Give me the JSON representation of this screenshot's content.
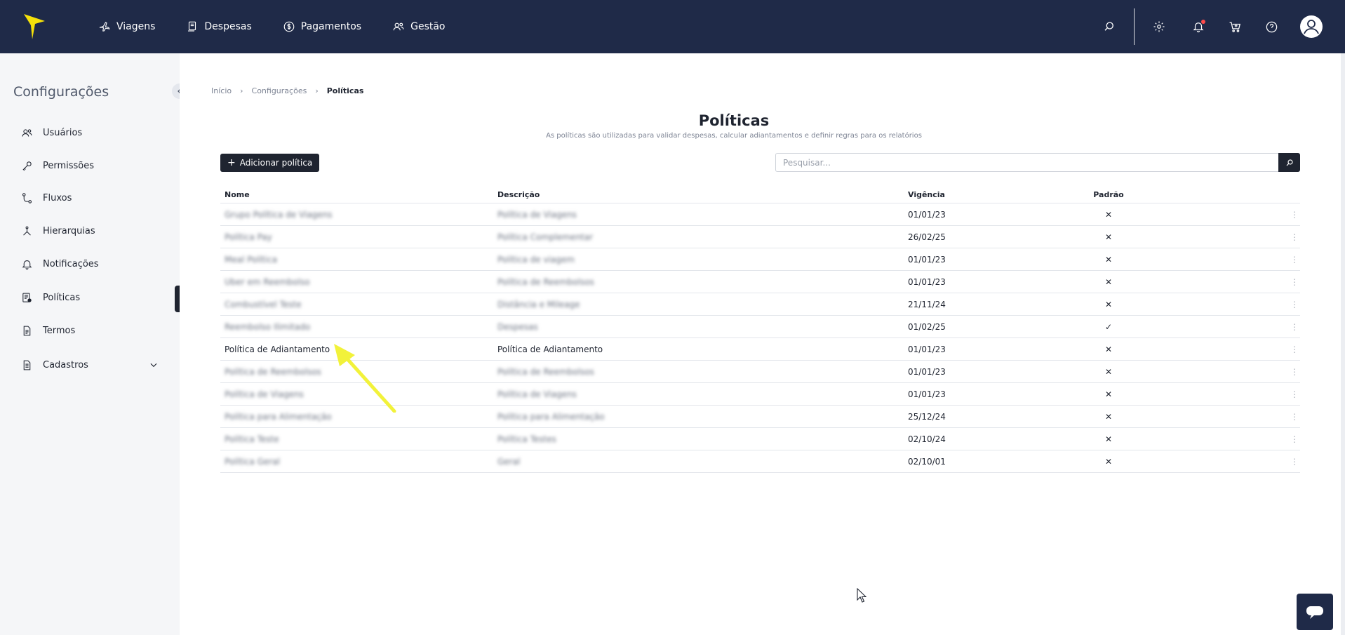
{
  "nav": {
    "items": [
      {
        "label": "Viagens",
        "icon": "plane-icon"
      },
      {
        "label": "Despesas",
        "icon": "receipt-icon"
      },
      {
        "label": "Pagamentos",
        "icon": "dollar-icon"
      },
      {
        "label": "Gestão",
        "icon": "users-icon"
      }
    ],
    "icons": [
      "search-icon",
      "gear-icon",
      "bell-icon",
      "cart-icon",
      "help-icon",
      "avatar-icon"
    ],
    "colors": {
      "navbar": "#1f2a48",
      "logo": "#f5e10a",
      "notification_dot": "#ff4b4b"
    }
  },
  "sidebar": {
    "title": "Configurações",
    "items": [
      {
        "label": "Usuários",
        "icon": "users-icon"
      },
      {
        "label": "Permissões",
        "icon": "key-icon"
      },
      {
        "label": "Fluxos",
        "icon": "flow-icon"
      },
      {
        "label": "Hierarquias",
        "icon": "hierarchy-icon"
      },
      {
        "label": "Notificações",
        "icon": "bell-icon"
      },
      {
        "label": "Políticas",
        "icon": "policy-icon",
        "active": true
      },
      {
        "label": "Termos",
        "icon": "document-icon"
      },
      {
        "label": "Cadastros",
        "icon": "records-icon",
        "expandable": true
      }
    ]
  },
  "breadcrumb": {
    "items": [
      "Início",
      "Configurações",
      "Políticas"
    ]
  },
  "page": {
    "title": "Políticas",
    "subtitle": "As políticas são utilizadas para validar despesas, calcular adiantamentos e definir regras para os relatórios"
  },
  "toolbar": {
    "add_label": "Adicionar política",
    "search_placeholder": "Pesquisar..."
  },
  "table": {
    "headers": {
      "nome": "Nome",
      "descricao": "Descrição",
      "vigencia": "Vigência",
      "padrao": "Padrão"
    },
    "rows": [
      {
        "nome": "Grupo Política de Viagens",
        "descricao": "Política de Viagens",
        "vigencia": "01/01/23",
        "padrao": "✕",
        "blurred": true
      },
      {
        "nome": "Política Pay",
        "descricao": "Política Complementar",
        "vigencia": "26/02/25",
        "padrao": "✕",
        "blurred": true
      },
      {
        "nome": "Meal Política",
        "descricao": "Política de viagem",
        "vigencia": "01/01/23",
        "padrao": "✕",
        "blurred": true
      },
      {
        "nome": "Uber em Reembolso",
        "descricao": "Política de Reembolsos",
        "vigencia": "01/01/23",
        "padrao": "✕",
        "blurred": true
      },
      {
        "nome": "Combustível Teste",
        "descricao": "Distância e Mileage",
        "vigencia": "21/11/24",
        "padrao": "✕",
        "blurred": true
      },
      {
        "nome": "Reembolso Ilimitado",
        "descricao": "Despesas",
        "vigencia": "01/02/25",
        "padrao": "✓",
        "blurred": true
      },
      {
        "nome": "Política de Adiantamento",
        "descricao": "Política de Adiantamento",
        "vigencia": "01/01/23",
        "padrao": "✕",
        "blurred": false
      },
      {
        "nome": "Política de Reembolsos",
        "descricao": "Política de Reembolsos",
        "vigencia": "01/01/23",
        "padrao": "✕",
        "blurred": true
      },
      {
        "nome": "Política de Viagens",
        "descricao": "Política de Viagens",
        "vigencia": "01/01/23",
        "padrao": "✕",
        "blurred": true
      },
      {
        "nome": "Política para Alimentação",
        "descricao": "Política para Alimentação",
        "vigencia": "25/12/24",
        "padrao": "✕",
        "blurred": true
      },
      {
        "nome": "Política Teste",
        "descricao": "Política Testes",
        "vigencia": "02/10/24",
        "padrao": "✕",
        "blurred": true
      },
      {
        "nome": "Política Geral",
        "descricao": "Geral",
        "vigencia": "02/10/01",
        "padrao": "✕",
        "blurred": true
      }
    ],
    "row_menu_icon": "kebab-icon"
  },
  "annotation": {
    "arrow_color": "#f2f23a"
  },
  "chat": {
    "icon": "chat-icon"
  }
}
